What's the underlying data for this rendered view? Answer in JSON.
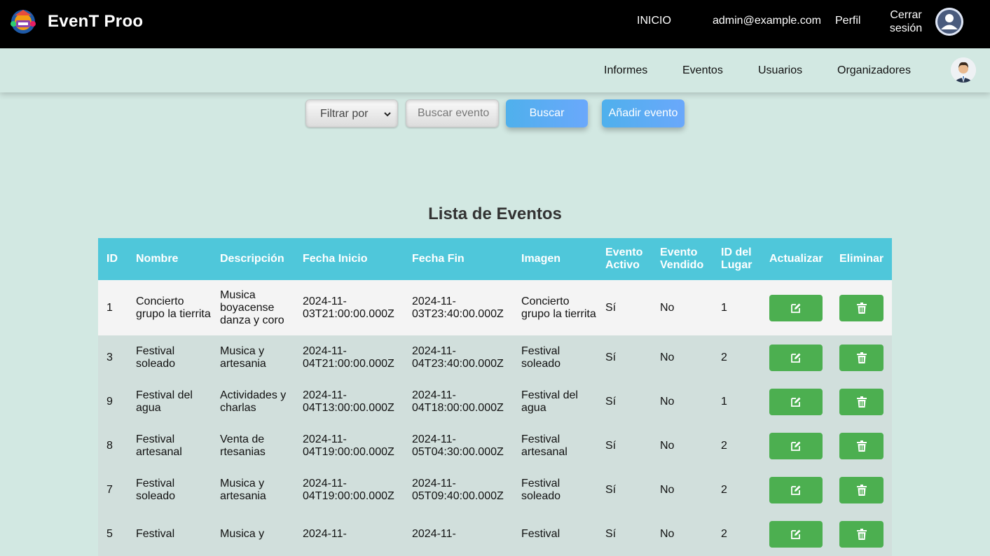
{
  "header": {
    "brand": "EvenT Proo",
    "nav": {
      "inicio": "INICIO",
      "email": "admin@example.com",
      "perfil": "Perfil",
      "logout_line1": "Cerrar",
      "logout_line2": "sesión"
    }
  },
  "subnav": {
    "items": [
      "Informes",
      "Eventos",
      "Usuarios",
      "Organizadores"
    ]
  },
  "search": {
    "filter_label": "Filtrar por",
    "placeholder": "Buscar evento",
    "search_button": "Buscar",
    "add_button": "Añadir evento"
  },
  "table": {
    "title": "Lista de Eventos",
    "headers": {
      "id": "ID",
      "nombre": "Nombre",
      "descripcion": "Descripción",
      "fecha_inicio": "Fecha Inicio",
      "fecha_fin": "Fecha Fin",
      "imagen": "Imagen",
      "activo_1": "Evento",
      "activo_2": "Activo",
      "vendido_1": "Evento",
      "vendido_2": "Vendido",
      "lugar_1": "ID del",
      "lugar_2": "Lugar",
      "actualizar": "Actualizar",
      "eliminar": "Eliminar"
    },
    "rows": [
      {
        "id": "1",
        "nombre": "Concierto grupo la tierrita",
        "descripcion": "Musica boyacense danza y coro",
        "inicio_1": "2024-11-",
        "inicio_2": "03T21:00:00.000Z",
        "fin_1": "2024-11-",
        "fin_2": "03T23:40:00.000Z",
        "imagen": "Concierto grupo la tierrita",
        "activo": "Sí",
        "vendido": "No",
        "lugar": "1"
      },
      {
        "id": "3",
        "nombre": "Festival soleado",
        "descripcion": "Musica y artesania",
        "inicio_1": "2024-11-",
        "inicio_2": "04T21:00:00.000Z",
        "fin_1": "2024-11-",
        "fin_2": "04T23:40:00.000Z",
        "imagen": "Festival soleado",
        "activo": "Sí",
        "vendido": "No",
        "lugar": "2"
      },
      {
        "id": "9",
        "nombre": "Festival del agua",
        "descripcion": "Actividades y charlas",
        "inicio_1": "2024-11-",
        "inicio_2": "04T13:00:00.000Z",
        "fin_1": "2024-11-",
        "fin_2": "04T18:00:00.000Z",
        "imagen": "Festival del agua",
        "activo": "Sí",
        "vendido": "No",
        "lugar": "1"
      },
      {
        "id": "8",
        "nombre": "Festival artesanal",
        "descripcion": "Venta de rtesanias",
        "inicio_1": "2024-11-",
        "inicio_2": "04T19:00:00.000Z",
        "fin_1": "2024-11-",
        "fin_2": "05T04:30:00.000Z",
        "imagen": "Festival artesanal",
        "activo": "Sí",
        "vendido": "No",
        "lugar": "2"
      },
      {
        "id": "7",
        "nombre": "Festival soleado",
        "descripcion": "Musica y artesania",
        "inicio_1": "2024-11-",
        "inicio_2": "04T19:00:00.000Z",
        "fin_1": "2024-11-",
        "fin_2": "05T09:40:00.000Z",
        "imagen": "Festival soleado",
        "activo": "Sí",
        "vendido": "No",
        "lugar": "2"
      },
      {
        "id": "5",
        "nombre": "Festival",
        "descripcion": "Musica y",
        "inicio_1": "2024-11-",
        "inicio_2": "",
        "fin_1": "2024-11-",
        "fin_2": "",
        "imagen": "Festival",
        "activo": "Sí",
        "vendido": "No",
        "lugar": "2"
      }
    ]
  },
  "icons": {
    "logo": "event-logo-icon",
    "user": "user-avatar-icon",
    "profile_photo": "profile-photo",
    "edit": "edit-icon",
    "delete": "trash-icon",
    "select": "chevron-down-icon"
  },
  "colors": {
    "topbar": "#000000",
    "background": "#d2e8e2",
    "table_header": "#4fc7da",
    "action_green": "#4caf50",
    "button_blue": "#5aaef2"
  }
}
